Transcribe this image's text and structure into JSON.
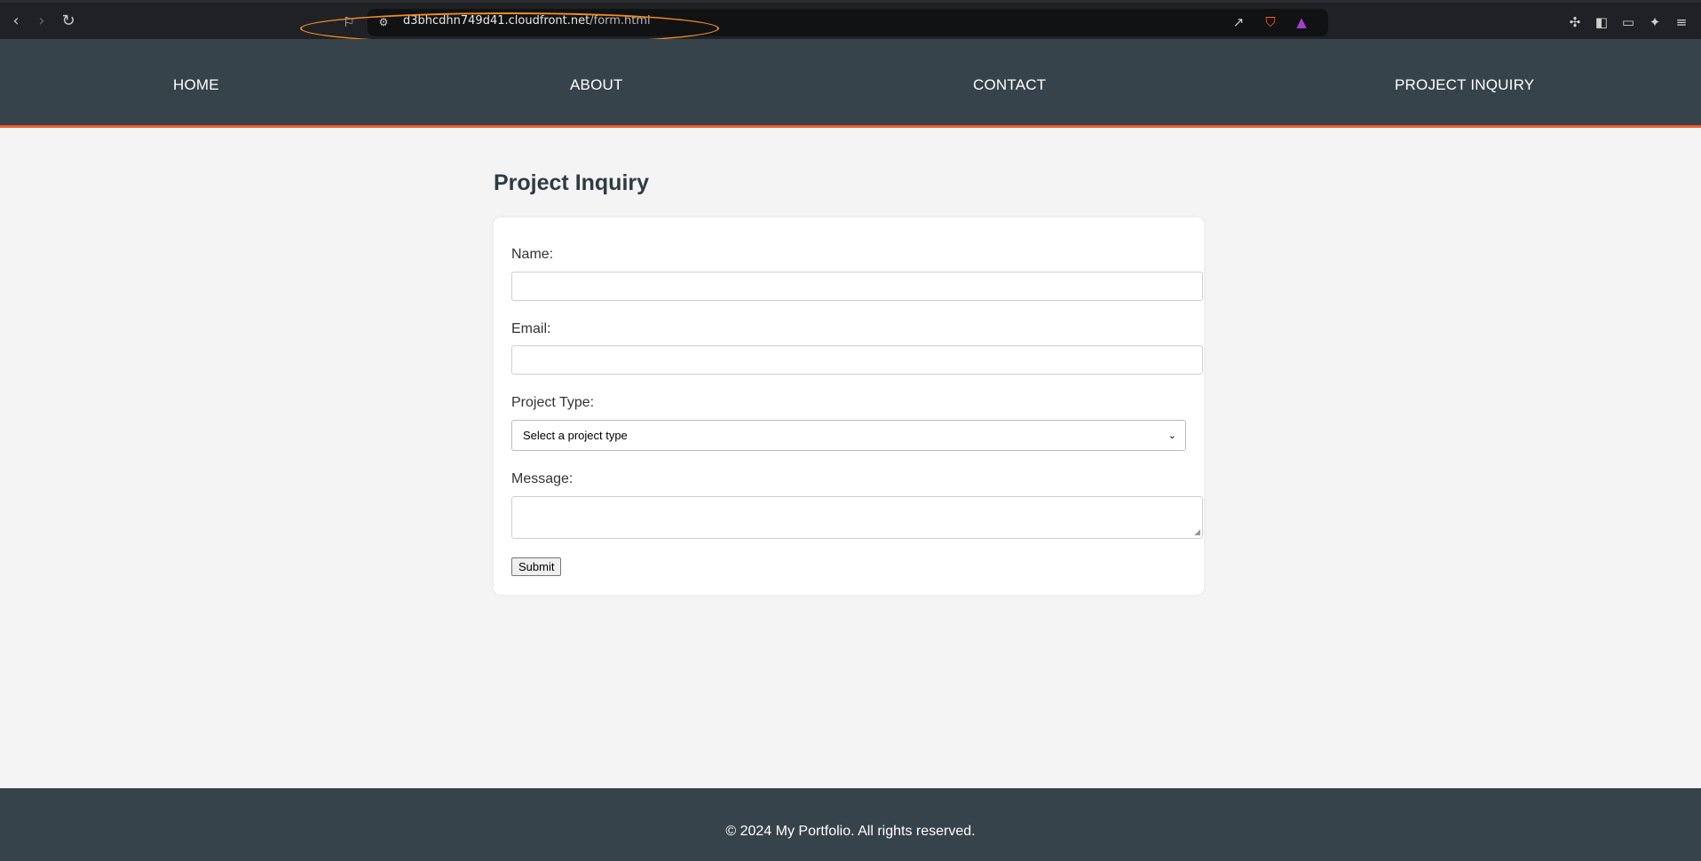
{
  "browser": {
    "url_host": "d3bhcdhn749d41.cloudfront.net",
    "url_path": "/form.html"
  },
  "nav": {
    "home": "HOME",
    "about": "ABOUT",
    "contact": "CONTACT",
    "project_inquiry": "PROJECT INQUIRY"
  },
  "page": {
    "title": "Project Inquiry"
  },
  "form": {
    "name_label": "Name:",
    "name_value": "",
    "email_label": "Email:",
    "email_value": "",
    "project_type_label": "Project Type:",
    "project_type_selected": "Select a project type",
    "message_label": "Message:",
    "message_value": "",
    "submit_label": "Submit"
  },
  "footer": {
    "copyright": "© 2024 My Portfolio. All rights reserved."
  },
  "colors": {
    "header_bg": "#37434b",
    "accent": "#f05a28",
    "page_bg": "#f4f4f4",
    "annotation": "#f08a24"
  }
}
